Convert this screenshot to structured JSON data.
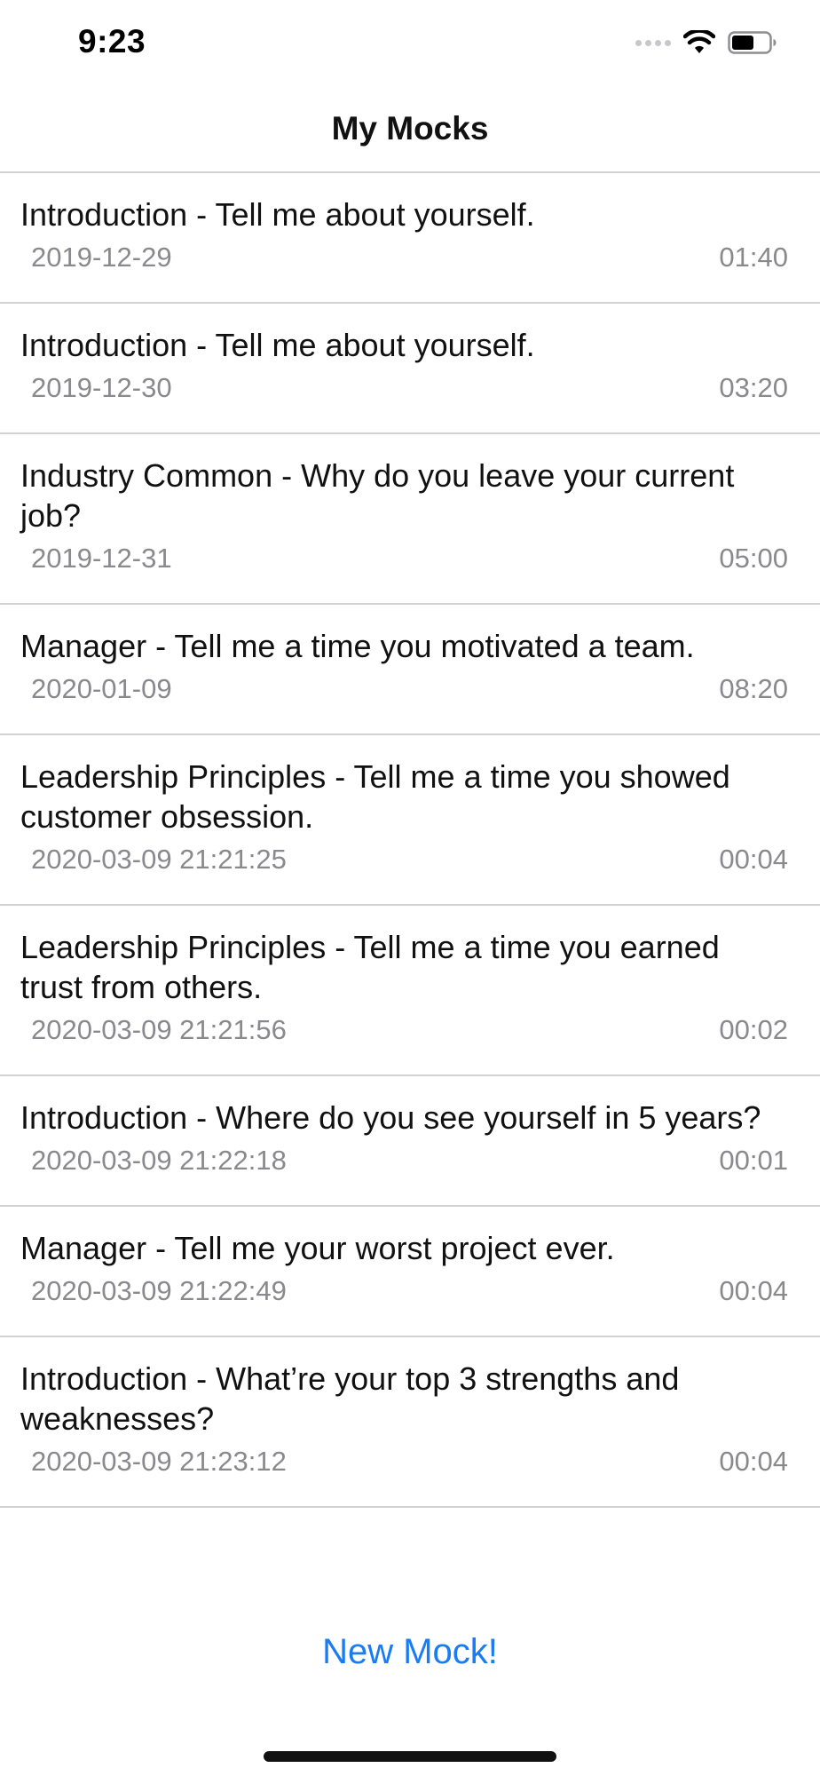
{
  "status_bar": {
    "time": "9:23",
    "icons": [
      "cellular-signal-icon",
      "wifi-icon",
      "battery-icon"
    ],
    "battery_level": 0.6
  },
  "nav": {
    "title": "My Mocks"
  },
  "mocks": [
    {
      "title": "Introduction - Tell me about yourself.",
      "date": "2019-12-29",
      "duration": "01:40"
    },
    {
      "title": "Introduction - Tell me about yourself.",
      "date": "2019-12-30",
      "duration": "03:20"
    },
    {
      "title": "Industry Common - Why do you leave your current job?",
      "date": "2019-12-31",
      "duration": "05:00"
    },
    {
      "title": "Manager - Tell me a time you motivated a team.",
      "date": "2020-01-09",
      "duration": "08:20"
    },
    {
      "title": "Leadership Principles - Tell me a time you showed customer obsession.",
      "date": "2020-03-09 21:21:25",
      "duration": "00:04"
    },
    {
      "title": "Leadership Principles - Tell me a time you earned trust from others.",
      "date": "2020-03-09 21:21:56",
      "duration": "00:02"
    },
    {
      "title": "Introduction - Where do you see yourself in 5 years?",
      "date": "2020-03-09 21:22:18",
      "duration": "00:01"
    },
    {
      "title": "Manager - Tell me your worst project ever.",
      "date": "2020-03-09 21:22:49",
      "duration": "00:04"
    },
    {
      "title": "Introduction - What’re your top 3 strengths and weaknesses?",
      "date": "2020-03-09 21:23:12",
      "duration": "00:04"
    }
  ],
  "footer": {
    "new_mock_label": "New Mock!"
  },
  "colors": {
    "accent": "#1a7cf2",
    "separator": "#d1d1d6",
    "secondary_text": "#8a8a8e"
  }
}
